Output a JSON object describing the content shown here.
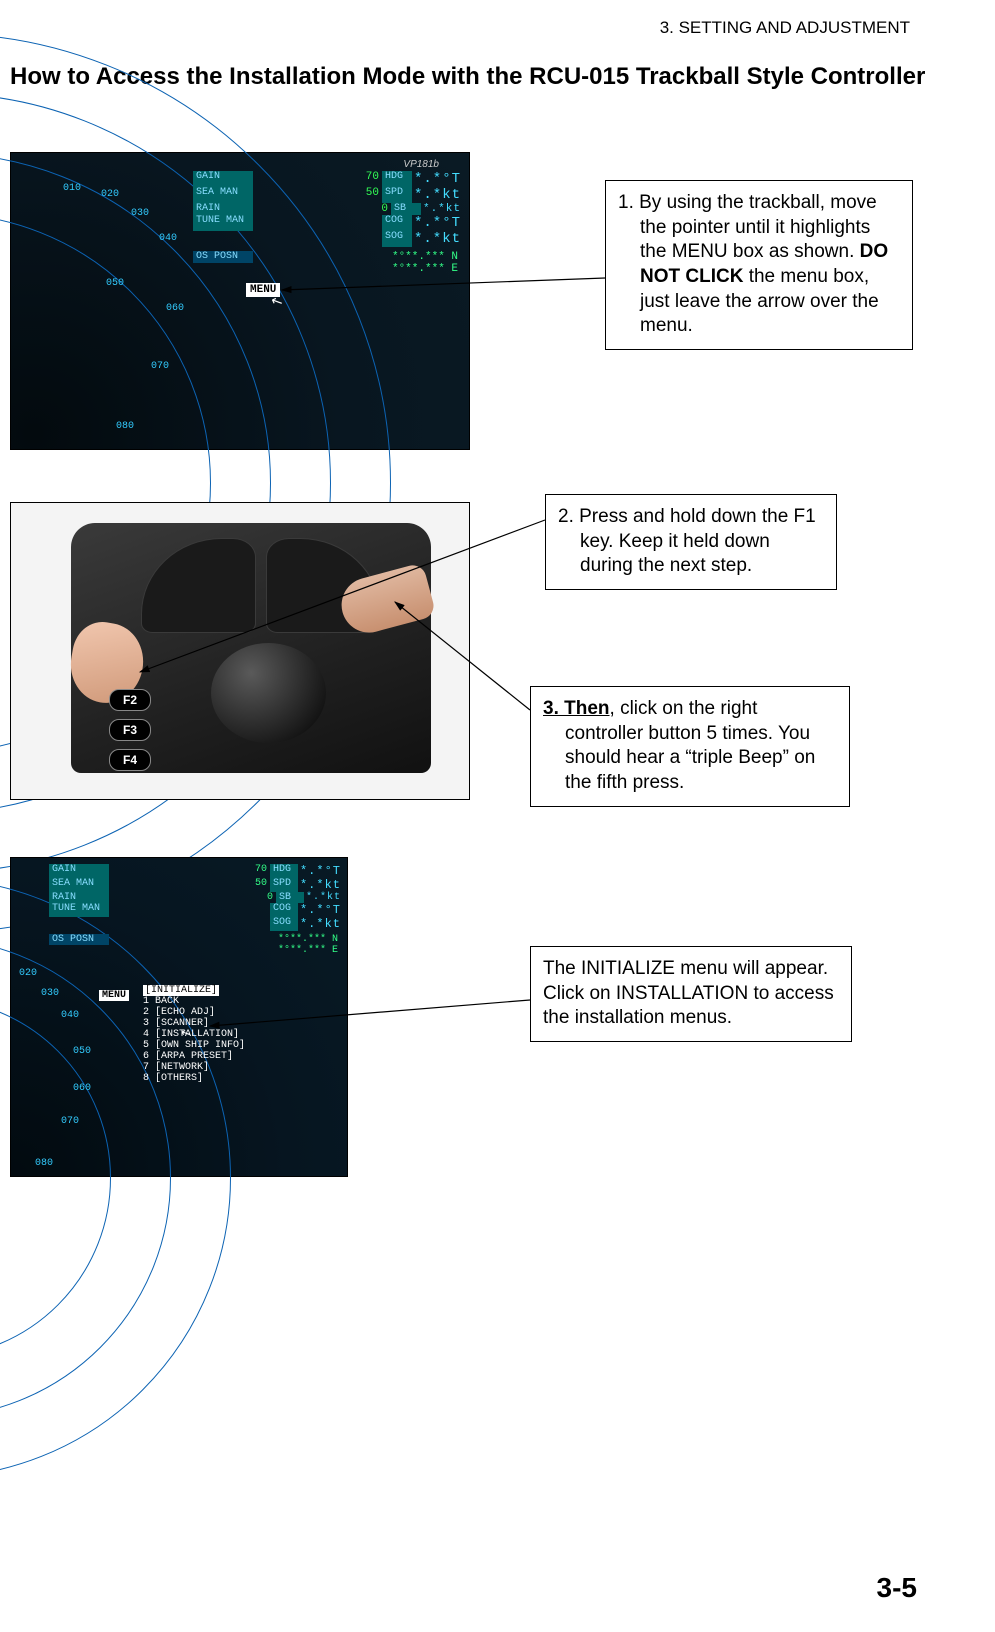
{
  "header": {
    "chapter": "3. SETTING AND ADJUSTMENT"
  },
  "title": "How to Access the Installation Mode with the RCU-015 Trackball Style Controller",
  "page_number": "3-5",
  "callouts": {
    "c1": {
      "prefix": "1. By using the trackball, move the pointer until it highlights the MENU box as shown. ",
      "bold1": "DO NOT CLICK",
      "suffix": " the menu box, just leave the arrow over the menu."
    },
    "c2": "2. Press and hold down the F1 key. Keep it held down during the next step.",
    "c3": {
      "bold1": "3. Then",
      "rest": ", click on the right controller button 5 times. You should hear a “triple Beep” on the fifth press."
    },
    "c4": "The INITIALIZE menu will appear. Click on INSTALLATION to access the installation menus."
  },
  "fig1": {
    "monitor_label": "VP181b",
    "rows": [
      {
        "lab": "GAIN",
        "mid": "70",
        "tag": "HDG",
        "big": "*.*°T"
      },
      {
        "lab": "SEA  MAN",
        "mid": "50",
        "tag": "SPD",
        "big": "*.*kt"
      },
      {
        "lab": "RAIN",
        "mid": "0",
        "tag": "SB",
        "big": "*.*kt"
      },
      {
        "lab": "TUNE MAN",
        "mid": "",
        "tag": "COG",
        "big": "*.*°T"
      },
      {
        "lab": "",
        "mid": "",
        "tag": "SOG",
        "big": "*.*kt"
      }
    ],
    "posn_row": {
      "lab": "OS POSN",
      "val1": "*°**.*** N",
      "val2": "*°**.*** E"
    },
    "menu_label": "MENU",
    "degree_ticks": [
      "010",
      "020",
      "030",
      "040",
      "050",
      "060",
      "070",
      "080"
    ]
  },
  "fig2": {
    "fkeys": [
      "F2",
      "F3",
      "F4"
    ]
  },
  "fig3": {
    "rows": [
      {
        "lab": "GAIN",
        "mid": "70",
        "tag": "HDG",
        "big": "*.*°T"
      },
      {
        "lab": "SEA  MAN",
        "mid": "50",
        "tag": "SPD",
        "big": "*.*kt"
      },
      {
        "lab": "RAIN",
        "mid": "0",
        "tag": "SB",
        "big": "*.*kt"
      },
      {
        "lab": "TUNE MAN",
        "mid": "",
        "tag": "COG",
        "big": "*.*°T"
      },
      {
        "lab": "",
        "mid": "",
        "tag": "SOG",
        "big": "*.*kt"
      }
    ],
    "posn_row": {
      "lab": "OS POSN",
      "val1": "*°**.*** N",
      "val2": "*°**.*** E"
    },
    "menu_label": "MENU",
    "init_header": "[INITIALIZE]",
    "init_items": [
      "1 BACK",
      "2 [ECHO ADJ]",
      "3 [SCANNER]",
      "4 [INSTALLATION]",
      "5 [OWN SHIP INFO]",
      "6 [ARPA PRESET]",
      "7 [NETWORK]",
      "8 [OTHERS]"
    ],
    "degree_ticks": [
      "020",
      "030",
      "040",
      "050",
      "060",
      "070",
      "080"
    ]
  }
}
